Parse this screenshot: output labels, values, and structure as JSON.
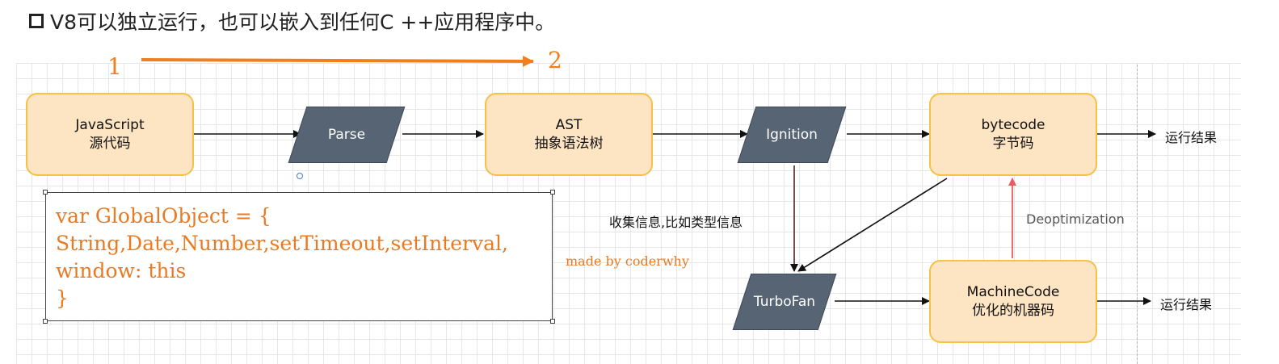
{
  "heading": "V8可以独立运行，也可以嵌入到任何C ++应用程序中。",
  "annotation": {
    "start_number": "1",
    "end_number": "2",
    "arrow_color": "#f07f1c"
  },
  "nodes": {
    "js_source": {
      "line1": "JavaScript",
      "line2": "源代码"
    },
    "parse": {
      "label": "Parse"
    },
    "ast": {
      "line1": "AST",
      "line2": "抽象语法树"
    },
    "ignition": {
      "label": "Ignition"
    },
    "bytecode": {
      "line1": "bytecode",
      "line2": "字节码"
    },
    "turbofan": {
      "label": "TurboFan"
    },
    "machinecode": {
      "line1": "MachineCode",
      "line2": "优化的机器码"
    }
  },
  "edge_labels": {
    "collect_info": "收集信息,比如类型信息",
    "deoptimization": "Deoptimization",
    "result_top": "运行结果",
    "result_bottom": "运行结果"
  },
  "code_block": {
    "lines": [
      "var GlobalObject = {",
      "String,Date,Number,setTimeout,setInterval,",
      "window: this",
      "}"
    ]
  },
  "watermark": "made by coderwhy",
  "colors": {
    "process_box_fill": "#fde4c2",
    "process_box_border": "#f5c146",
    "parallelogram_fill": "#566474",
    "code_text": "#e97a22",
    "deopt_arrow": "#e85d5d"
  }
}
